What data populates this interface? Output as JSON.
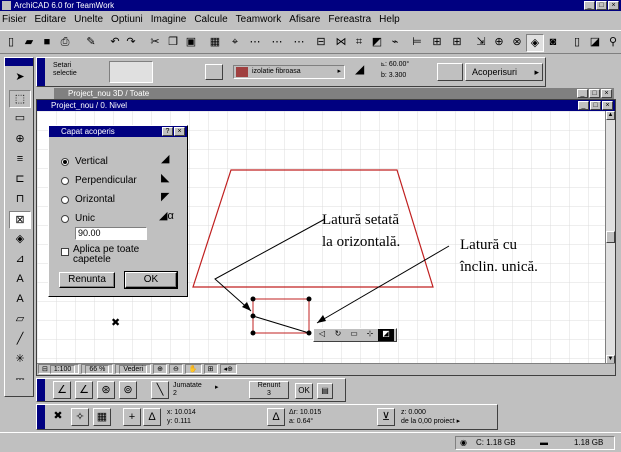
{
  "app": {
    "title": "ArchiCAD 6.0 for TeamWork"
  },
  "menu": [
    "Fisier",
    "Editare",
    "Unelte",
    "Optiuni",
    "Imagine",
    "Calcule",
    "Teamwork",
    "Afisare",
    "Fereastra",
    "Help"
  ],
  "infobox": {
    "settings_label": "Setari selectie",
    "material_label": "izolatie fibroasa",
    "angle1": "60.00°",
    "angle_b": "3.300",
    "roofs_label": "Acoperisuri"
  },
  "windows": {
    "view3d_title": "Project_nou 3D / Toate",
    "plan_title": "Project_nou / 0. Nivel"
  },
  "dialog": {
    "title": "Capat acoperis",
    "help": "?",
    "options": [
      {
        "label": "Vertical",
        "selected": true
      },
      {
        "label": "Perpendicular",
        "selected": false
      },
      {
        "label": "Orizontal",
        "selected": false
      },
      {
        "label": "Unic",
        "selected": false
      }
    ],
    "unic_value": "90.00",
    "apply_all_label": "Aplica pe toate capetele",
    "cancel_label": "Renunta",
    "ok_label": "OK"
  },
  "annotations": {
    "line1a": "Latură setată",
    "line1b": "la orizontală.",
    "line2a": "Latură cu",
    "line2b": "înclin. unică."
  },
  "statusbar": {
    "scale": "1:100",
    "zoom": "66 %",
    "view": "Vederi"
  },
  "controlbox": {
    "jumatate": "Jumatate",
    "jumatate_n": "2",
    "renunt": "Renunt",
    "renunt_n": "3",
    "ok": "OK"
  },
  "coords": {
    "x": "10.014",
    "y": "0.111",
    "dr": "10.015",
    "a": "0.64°",
    "z": "0.000",
    "z_ref": "de la 0,00 proiect"
  },
  "taskbar": {
    "drive_c": "C: 1.18 GB",
    "drive_2": "1.18 GB"
  }
}
